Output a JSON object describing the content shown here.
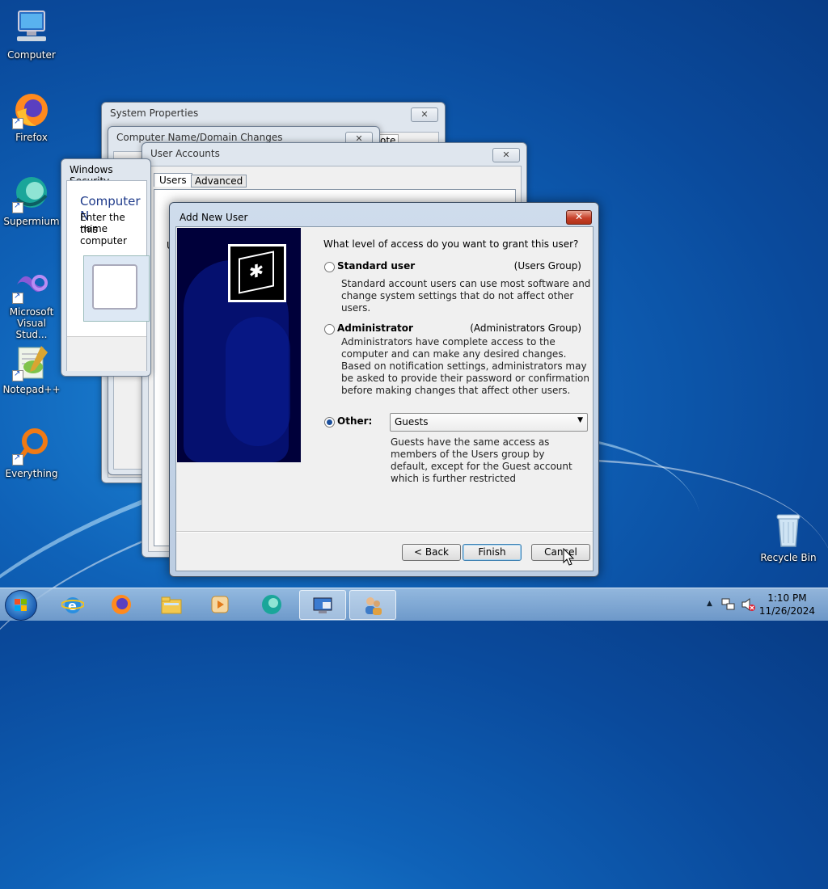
{
  "desktop": {
    "icons": [
      {
        "label": "Computer",
        "icon": "computer-icon"
      },
      {
        "label": "Firefox",
        "icon": "firefox-icon"
      },
      {
        "label": "Supermium",
        "icon": "supermium-icon"
      },
      {
        "label": "Microsoft Visual Stud...",
        "icon": "visual-studio-icon"
      },
      {
        "label": "Notepad++",
        "icon": "notepadpp-icon"
      },
      {
        "label": "Everything",
        "icon": "everything-icon"
      },
      {
        "label": "Recycle Bin",
        "icon": "recycle-bin-icon"
      }
    ]
  },
  "bg_windows": {
    "system_properties": {
      "title": "System Properties",
      "tab_fragment": "ote"
    },
    "computer_name": {
      "title": "Computer Name/Domain Changes"
    },
    "windows_security": {
      "title": "Windows Security",
      "heading": "Computer N",
      "text1": "Enter the name",
      "text2": "this computer"
    },
    "user_accounts": {
      "title": "User Accounts",
      "tabs": [
        "Users",
        "Advanced"
      ],
      "fragment": "U"
    }
  },
  "dialog": {
    "title": "Add New User",
    "close": "✕",
    "question": "What level of access do you want to grant this user?",
    "standard": {
      "label": "Standard user",
      "group": "(Users Group)",
      "desc": "Standard account users can use most software and change system settings that do not affect other users."
    },
    "administrator": {
      "label": "Administrator",
      "group": "(Administrators Group)",
      "desc": "Administrators have complete access to the computer and can make any desired changes. Based on notification settings, administrators may be asked to provide their password or confirmation before making changes that affect other users."
    },
    "other": {
      "label": "Other:",
      "selected": "Guests",
      "desc": "Guests have the same access as members of the Users group by default, except for the Guest account which is further restricted"
    },
    "selected_option": "other",
    "buttons": {
      "back": "< Back",
      "finish": "Finish",
      "cancel": "Cancel"
    }
  },
  "taskbar": {
    "apps": [
      "internet-explorer-icon",
      "firefox-icon",
      "file-explorer-icon",
      "media-player-icon",
      "supermium-icon",
      "system-properties-icon",
      "user-accounts-icon"
    ],
    "clock": {
      "time": "1:10 PM",
      "date": "11/26/2024"
    },
    "colors": {
      "accent": "#1b4f9c",
      "close": "#c7402a"
    }
  }
}
